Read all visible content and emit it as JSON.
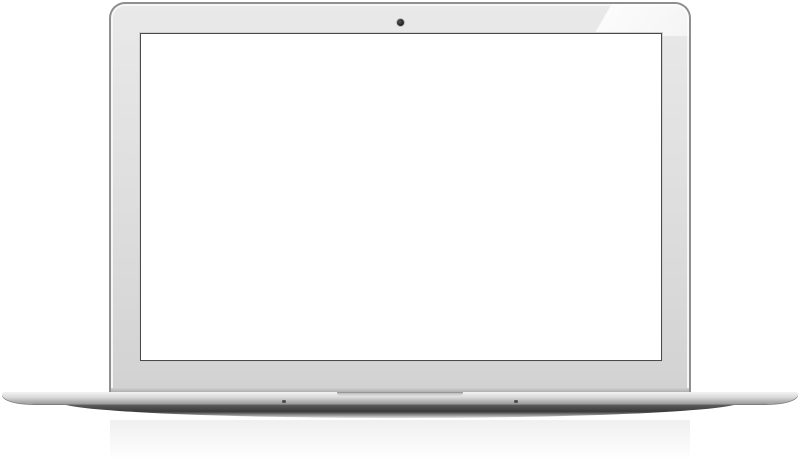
{
  "device": {
    "type": "laptop",
    "screen_content": ""
  },
  "colors": {
    "screen": "#ffffff",
    "bezel": "#e0e0e0",
    "frame": "#8f8f8f",
    "base_shadow": "#3a3a3a"
  },
  "icons": {
    "camera": "camera-icon"
  }
}
